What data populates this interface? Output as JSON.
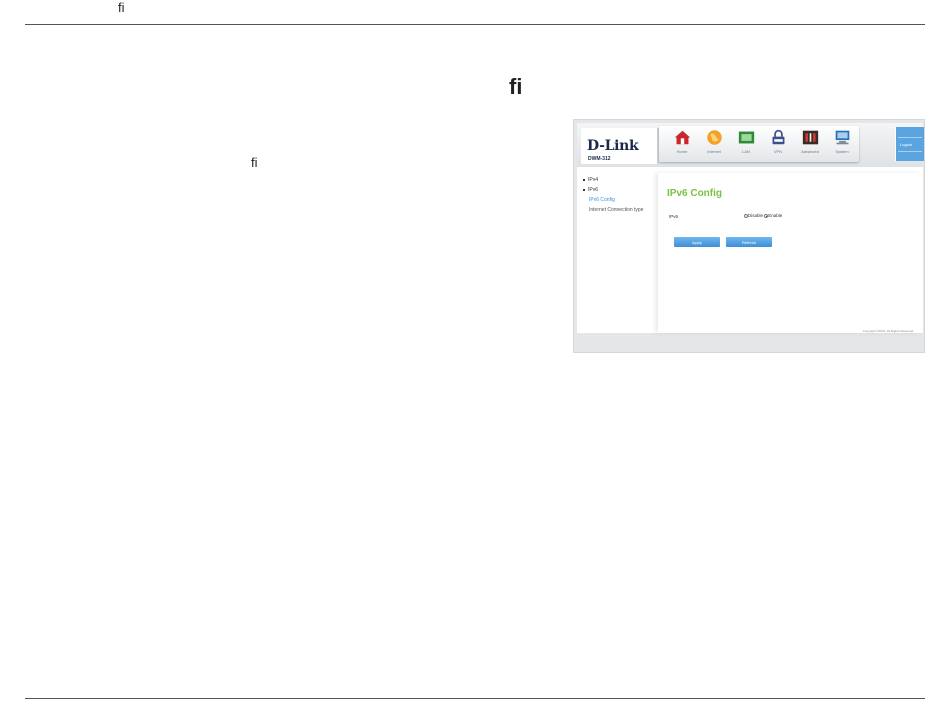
{
  "header": {
    "ligature": "ﬁ"
  },
  "section": {
    "heading_glyph": "ﬁ",
    "body_glyph": "ﬁ"
  },
  "screenshot": {
    "brand": "D-Link",
    "model": "DWM-312",
    "nav": [
      {
        "label": "Home",
        "icon": "home-icon"
      },
      {
        "label": "Internet",
        "icon": "globe-icon"
      },
      {
        "label": "LAN",
        "icon": "lan-icon"
      },
      {
        "label": "VPN",
        "icon": "vpn-lock-icon"
      },
      {
        "label": "Advanced",
        "icon": "advanced-icon"
      },
      {
        "label": "System",
        "icon": "system-monitor-icon"
      }
    ],
    "logout_label": "Logout",
    "sidebar": {
      "items": [
        {
          "label": "IPv4"
        },
        {
          "label": "IPv6"
        }
      ],
      "subitems": [
        {
          "label": "IPv6 Config"
        },
        {
          "label": "Internet Connection type"
        }
      ]
    },
    "page_title": "IPv6 Config",
    "field_label": "IPv6",
    "radio_disable": "Disable",
    "radio_enable": "Enable",
    "apply_label": "Apply",
    "refresh_label": "Refresh",
    "copyright": "Copyright ©2016. All Rights Reserved."
  },
  "colors": {
    "accent_green": "#7ac143",
    "button_blue": "#4a9ae0",
    "brand_navy": "#1b2a4a"
  }
}
